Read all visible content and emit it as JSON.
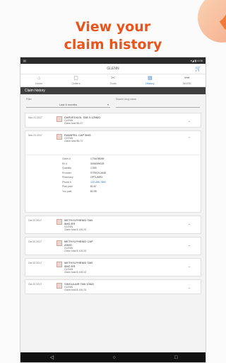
{
  "promo": {
    "headline_line1": "View your",
    "headline_line2": "claim history"
  },
  "status": {
    "left": "▤",
    "right": "▾◢ ▮ 4:06"
  },
  "header": {
    "title": "GLENN",
    "cart_icon": "cart-icon"
  },
  "nav": [
    {
      "label": "Home",
      "icon": "⌂"
    },
    {
      "label": "Orders",
      "icon": "▢"
    },
    {
      "label": "Tools",
      "icon": "✂"
    },
    {
      "label": "History",
      "icon": "▤"
    },
    {
      "label": "MORE",
      "icon": "•••"
    }
  ],
  "section": {
    "title": "Claim history"
  },
  "filters": {
    "filter_label": "Filter",
    "filter_value": "Last 6 months",
    "search_label": "Search drug name",
    "search_placeholder": ""
  },
  "claims": [
    {
      "date": "Nov 21 2017",
      "drug": "CARVEDILOL TAB 3.125MG",
      "member": "GLENN",
      "total": "Claim total $6.37",
      "expanded": false
    },
    {
      "date": "Nov 21 2017",
      "drug": "RAMIPRIL CAP 5MG",
      "member": "GLENN",
      "total": "Claim total $6.72",
      "expanded": true,
      "details": [
        {
          "k": "Claim #",
          "v": "1734198069",
          "link": false
        },
        {
          "k": "Rx #",
          "v": "0006099025",
          "link": false
        },
        {
          "k": "Quantity",
          "v": "1.000",
          "link": false
        },
        {
          "k": "Provider",
          "v": "STRICKLAND",
          "link": false
        },
        {
          "k": "Pharmacy",
          "v": "OPTUMRX",
          "link": false
        },
        {
          "k": "Phone #",
          "v": "123-456-7890",
          "link": true
        },
        {
          "k": "Plan paid",
          "v": "$1.67",
          "link": false
        },
        {
          "k": "You paid",
          "v": "$4.95",
          "link": false
        }
      ]
    },
    {
      "date": "Oct 20 2017",
      "drug": "METHYLPHENID TAB",
      "drug2": "5MG ER",
      "member": "GLENN",
      "total": "Claim total $ 106.23",
      "expanded": false
    },
    {
      "date": "Oct 20 2017",
      "drug": "METHYLPHENID CAP",
      "drug2": "20MG",
      "member": "GLENN",
      "total": "Claim total $ 106.23",
      "expanded": false
    },
    {
      "date": "Oct 20 2017",
      "drug": "METHYLPHENID TAB",
      "drug2": "5MG ER",
      "member": "GLENN",
      "total": "Claim total $ 106.23",
      "expanded": false
    },
    {
      "date": "Oct 20 2017",
      "drug": "SINGULAIR TAB 10MG",
      "member": "GLENN",
      "total": "Claim total $ 106.23",
      "expanded": false
    }
  ],
  "softkeys": {
    "back": "◁",
    "home": "○",
    "recent": "□"
  }
}
